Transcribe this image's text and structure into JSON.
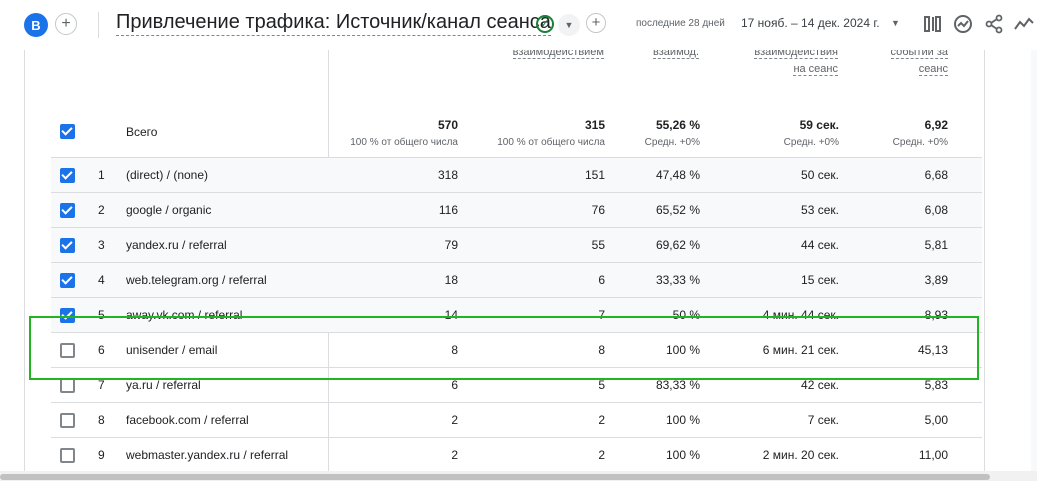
{
  "header": {
    "avatar_letter": "B",
    "report_title": "Привлечение трафика: Источник/канал сеанса",
    "date_label": "последние 28 дней",
    "date_range": "17 нояб. – 14 дек. 2024 г.",
    "icons": [
      "customize-icon",
      "insights-icon",
      "share-icon",
      "compare-icon"
    ]
  },
  "columns": [
    {
      "line1": "взаимодействием",
      "line2": ""
    },
    {
      "line1": "взаимод.",
      "line2": ""
    },
    {
      "line1": "взаимодействия",
      "line2": "на сеанс"
    },
    {
      "line1": "событий за",
      "line2": "сеанс"
    }
  ],
  "totals": {
    "label": "Всего",
    "values": [
      "570",
      "315",
      "55,26 %",
      "59 сек.",
      "6,92"
    ],
    "subs": [
      "100 % от общего числа",
      "100 % от общего числа",
      "Средн. +0%",
      "Средн. +0%",
      "Средн. +0%"
    ],
    "checked": true
  },
  "rows": [
    {
      "n": "1",
      "label": "(direct) / (none)",
      "checked": true,
      "values": [
        "318",
        "151",
        "47,48 %",
        "50 сек.",
        "6,68"
      ]
    },
    {
      "n": "2",
      "label": "google / organic",
      "checked": true,
      "values": [
        "116",
        "76",
        "65,52 %",
        "53 сек.",
        "6,08"
      ]
    },
    {
      "n": "3",
      "label": "yandex.ru / referral",
      "checked": true,
      "values": [
        "79",
        "55",
        "69,62 %",
        "44 сек.",
        "5,81"
      ]
    },
    {
      "n": "4",
      "label": "web.telegram.org / referral",
      "checked": true,
      "values": [
        "18",
        "6",
        "33,33 %",
        "15 сек.",
        "3,89"
      ]
    },
    {
      "n": "5",
      "label": "away.vk.com / referral",
      "checked": true,
      "values": [
        "14",
        "7",
        "50 %",
        "4 мин. 44 сек.",
        "8,93"
      ]
    },
    {
      "n": "6",
      "label": "unisender / email",
      "checked": false,
      "values": [
        "8",
        "8",
        "100 %",
        "6 мин. 21 сек.",
        "45,13"
      ]
    },
    {
      "n": "7",
      "label": "ya.ru / referral",
      "checked": false,
      "values": [
        "6",
        "5",
        "83,33 %",
        "42 сек.",
        "5,83"
      ]
    },
    {
      "n": "8",
      "label": "facebook.com / referral",
      "checked": false,
      "values": [
        "2",
        "2",
        "100 %",
        "7 сек.",
        "5,00"
      ]
    },
    {
      "n": "9",
      "label": "webmaster.yandex.ru / referral",
      "checked": false,
      "values": [
        "2",
        "2",
        "100 %",
        "2 мин. 20 сек.",
        "11,00"
      ]
    }
  ],
  "colors": {
    "accent": "#1a73e8",
    "highlight": "#22b422"
  }
}
